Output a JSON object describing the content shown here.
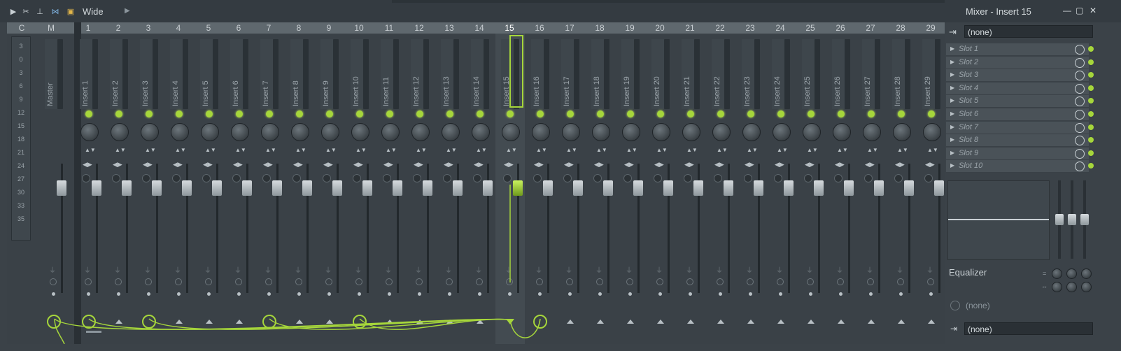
{
  "topbar": {
    "preset_label": "Wide",
    "icons": [
      "play-arrow-icon",
      "cut-icon",
      "pin-icon",
      "butterfly-icon",
      "square-icon"
    ]
  },
  "window": {
    "title": "Mixer - Insert 15",
    "controls": [
      "minimize",
      "maximize",
      "close"
    ]
  },
  "mixer": {
    "master_header": [
      "C",
      "M"
    ],
    "master_name": "Master",
    "selected_track": "15",
    "db_scale": [
      "3",
      "0",
      "3",
      "6",
      "9",
      "12",
      "15",
      "18",
      "21",
      "24",
      "27",
      "30",
      "33",
      "35"
    ],
    "tracks": [
      {
        "num": "1",
        "name": "Insert 1",
        "routed": true
      },
      {
        "num": "2",
        "name": "Insert 2",
        "routed": false
      },
      {
        "num": "3",
        "name": "Insert 3",
        "routed": true
      },
      {
        "num": "4",
        "name": "Insert 4",
        "routed": false
      },
      {
        "num": "5",
        "name": "Insert 5",
        "routed": false
      },
      {
        "num": "6",
        "name": "Insert 6",
        "routed": false
      },
      {
        "num": "7",
        "name": "Insert 7",
        "routed": true
      },
      {
        "num": "8",
        "name": "Insert 8",
        "routed": false
      },
      {
        "num": "9",
        "name": "Insert 9",
        "routed": false
      },
      {
        "num": "10",
        "name": "Insert 10",
        "routed": true
      },
      {
        "num": "11",
        "name": "Insert 11",
        "routed": false
      },
      {
        "num": "12",
        "name": "Insert 12",
        "routed": false
      },
      {
        "num": "13",
        "name": "Insert 13",
        "routed": false
      },
      {
        "num": "14",
        "name": "Insert 14",
        "routed": false
      },
      {
        "num": "15",
        "name": "Insert 15",
        "routed": false
      },
      {
        "num": "16",
        "name": "Insert 16",
        "routed": true
      },
      {
        "num": "17",
        "name": "Insert 17",
        "routed": false
      },
      {
        "num": "18",
        "name": "Insert 18",
        "routed": false
      },
      {
        "num": "19",
        "name": "Insert 19",
        "routed": false
      },
      {
        "num": "20",
        "name": "Insert 20",
        "routed": false
      },
      {
        "num": "21",
        "name": "Insert 21",
        "routed": false
      },
      {
        "num": "22",
        "name": "Insert 22",
        "routed": false
      },
      {
        "num": "23",
        "name": "Insert 23",
        "routed": false
      },
      {
        "num": "24",
        "name": "Insert 24",
        "routed": false
      },
      {
        "num": "25",
        "name": "Insert 25",
        "routed": false
      },
      {
        "num": "26",
        "name": "Insert 26",
        "routed": false
      },
      {
        "num": "27",
        "name": "Insert 27",
        "routed": false
      },
      {
        "num": "28",
        "name": "Insert 28",
        "routed": false
      },
      {
        "num": "29",
        "name": "Insert 29",
        "routed": false
      }
    ]
  },
  "panel": {
    "input": "(none)",
    "slots": [
      "Slot 1",
      "Slot 2",
      "Slot 3",
      "Slot 4",
      "Slot 5",
      "Slot 6",
      "Slot 7",
      "Slot 8",
      "Slot 9",
      "Slot 10"
    ],
    "eq_label": "Equalizer",
    "time_value": "(none)",
    "output": "(none)"
  },
  "colors": {
    "accent": "#a6d63b",
    "background": "#3b4248"
  }
}
